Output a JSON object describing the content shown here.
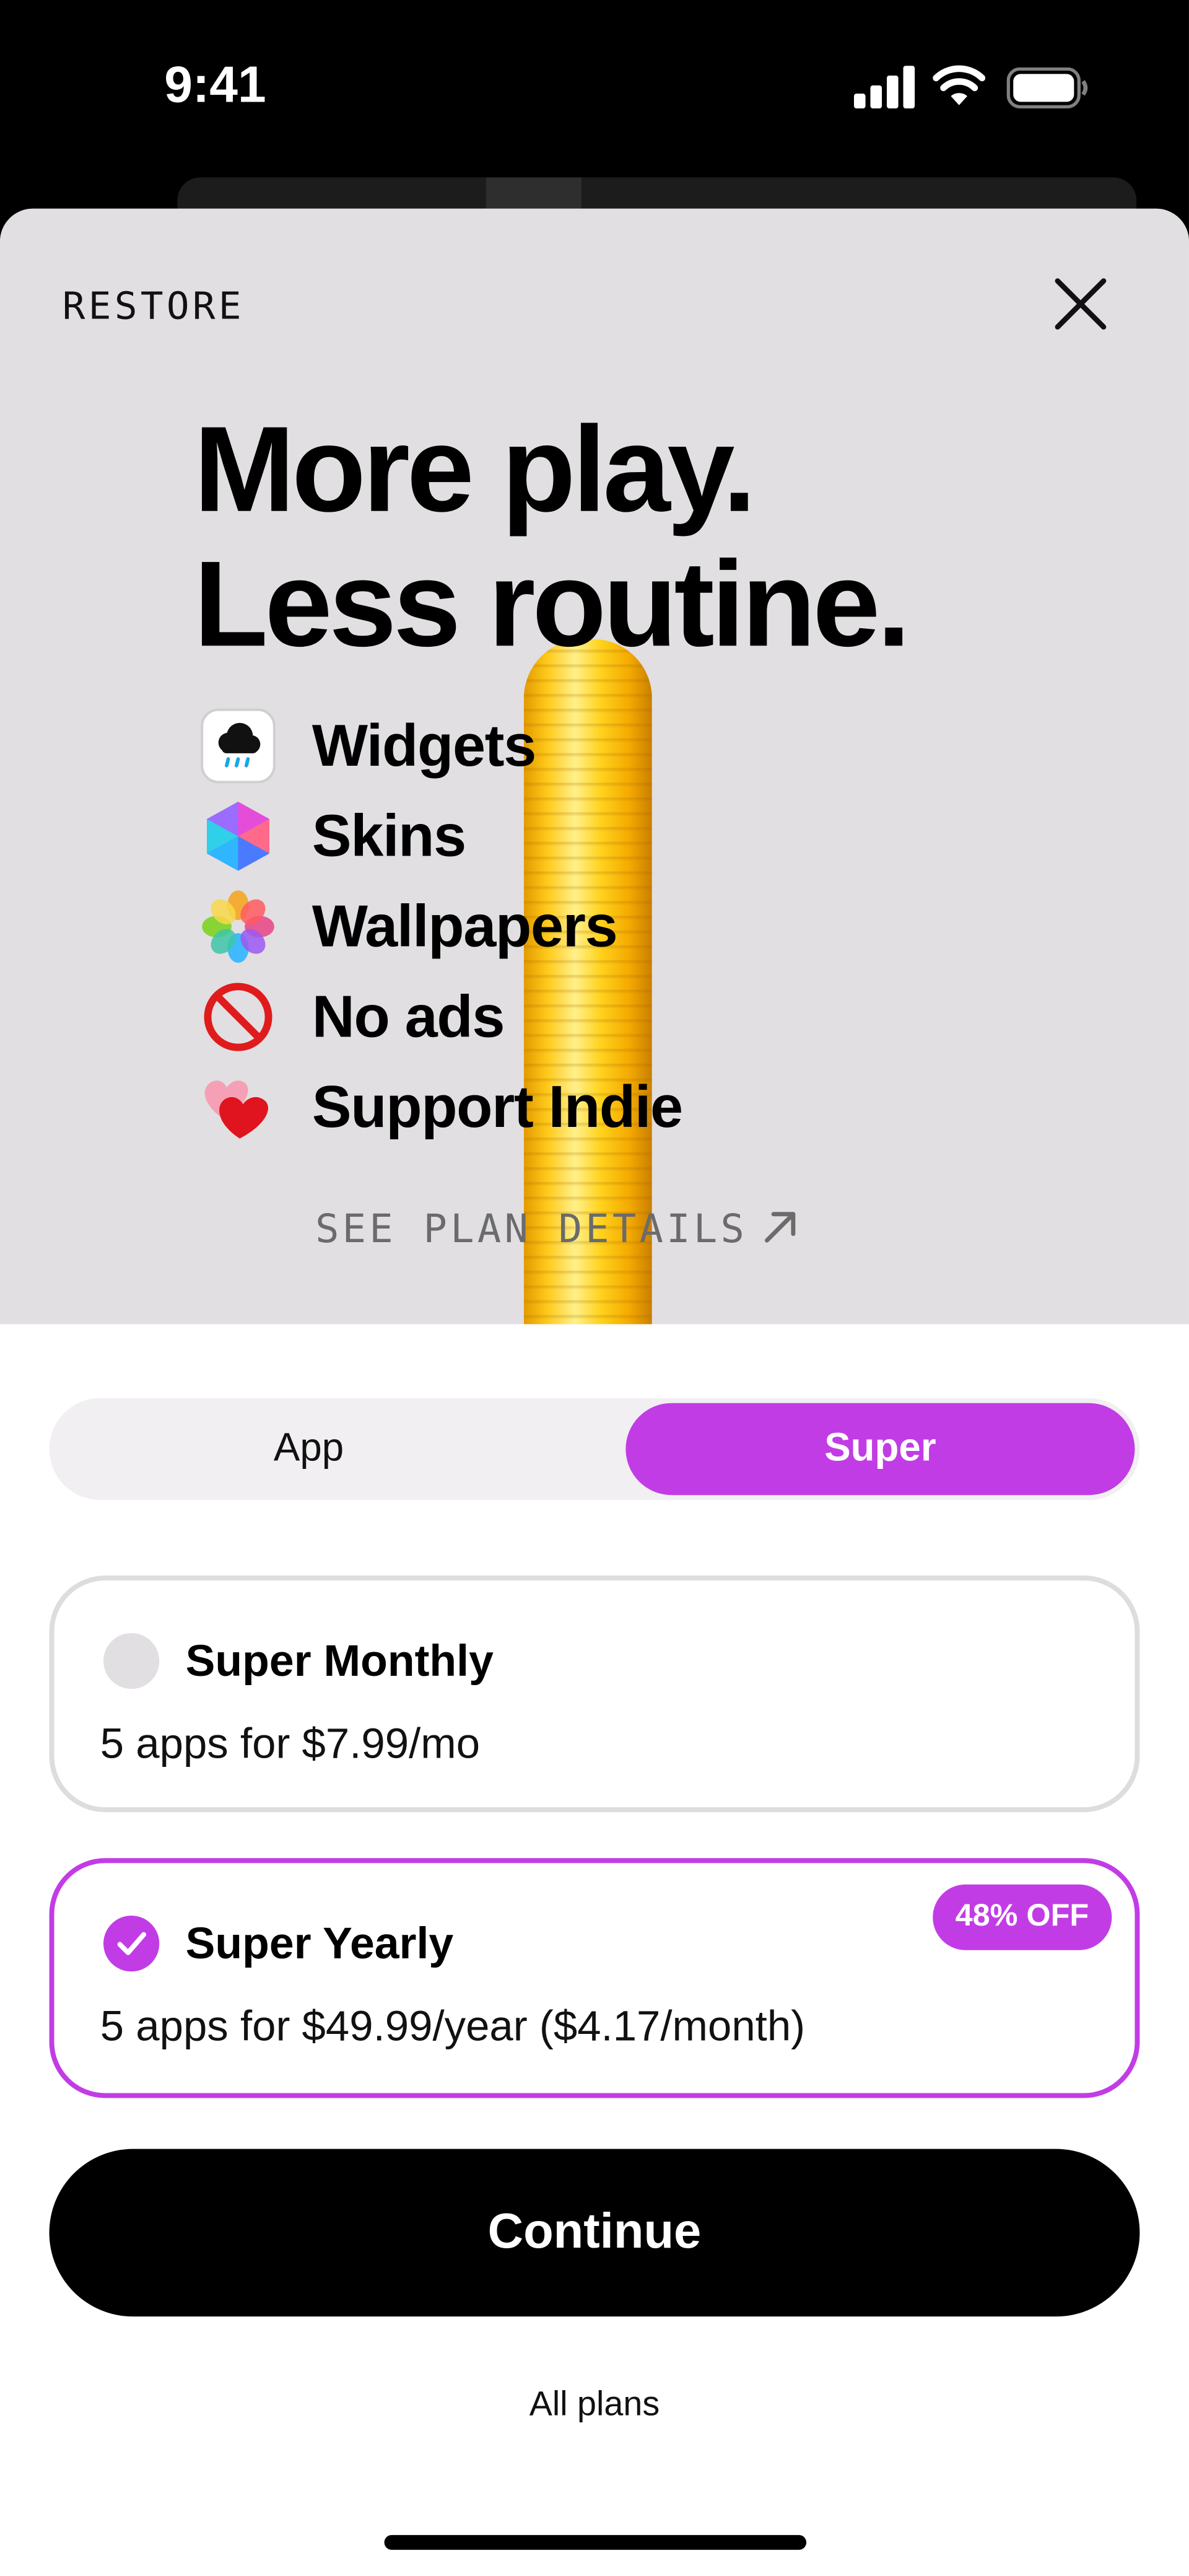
{
  "status_bar": {
    "time": "9:41"
  },
  "header": {
    "restore_label": "RESTORE"
  },
  "hero": {
    "headline_line1": "More play.",
    "headline_line2": "Less routine.",
    "features": [
      {
        "label": "Widgets",
        "icon": "cloud-rain-widget-icon"
      },
      {
        "label": "Skins",
        "icon": "hexagon-gem-icon"
      },
      {
        "label": "Wallpapers",
        "icon": "flower-photos-icon"
      },
      {
        "label": "No ads",
        "icon": "no-entry-icon"
      },
      {
        "label": "Support Indie",
        "icon": "hearts-icon"
      }
    ],
    "see_plan_details": "SEE PLAN DETAILS"
  },
  "tabs": {
    "app_label": "App",
    "super_label": "Super",
    "selected": "Super"
  },
  "plans": [
    {
      "title": "Super Monthly",
      "description": "5 apps for $7.99/mo",
      "selected": false
    },
    {
      "title": "Super Yearly",
      "description": "5 apps for $49.99/year ($4.17/month)",
      "badge": "48% OFF",
      "selected": true
    }
  ],
  "continue_label": "Continue",
  "all_plans_label": "All plans",
  "colors": {
    "accent": "#c23ce6",
    "hero_bg": "#e1dfe2",
    "button": "#000000"
  }
}
